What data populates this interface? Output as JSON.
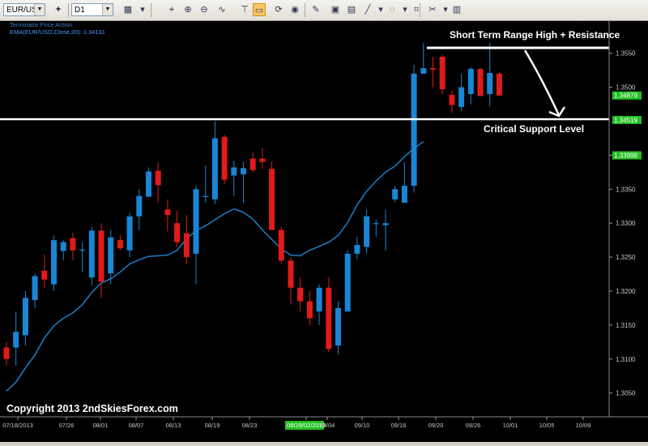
{
  "toolbar": {
    "symbol": "EUR/USD",
    "timeframe": "D1",
    "icons": [
      "add-symbol-icon",
      "layout-icon",
      "chart-type-icon",
      "crosshair-icon",
      "zoom-in-icon",
      "zoom-out-icon",
      "indicators-icon",
      "line-tool-icon",
      "text-tool-icon",
      "alert-icon",
      "template-icon",
      "save-icon",
      "print-icon",
      "draw-line-icon",
      "shape-icon",
      "flag-icon",
      "eraser-icon",
      "settings-icon"
    ]
  },
  "chart_header": {
    "line1": "Terminator Price Action",
    "line2": "EMA(EUR/USD,Close,20): 1.34131"
  },
  "annotations": {
    "resistance_label": "Short Term Range High + Resistance",
    "support_label": "Critical Support Level",
    "copyright": "Copyright 2013 2ndSkiesForex.com"
  },
  "colors": {
    "bull": "#1a86d6",
    "bear": "#e11b1b",
    "ema": "#1a86d6",
    "price_tag": "#22c022",
    "background": "#000000",
    "lines": "#ffffff"
  },
  "chart_data": {
    "type": "candlestick",
    "symbol": "EUR/USD",
    "timeframe": "D1",
    "ylim": [
      1.3015,
      1.3595
    ],
    "y_ticks": [
      "1.3550",
      "1.3500",
      "1.3400",
      "1.3350",
      "1.3300",
      "1.3250",
      "1.3200",
      "1.3150",
      "1.3100",
      "1.3050"
    ],
    "x_ticks": [
      "07/18/2013",
      "07/26",
      "08/01",
      "08/07",
      "08/13",
      "08/19",
      "08/23",
      "08/29/02/2013",
      "09/04",
      "09/10",
      "09/16",
      "09/20",
      "09/26",
      "10/01",
      "10/05",
      "10/09"
    ],
    "price_tags": [
      "1.34879",
      "1.34519",
      "1.33998"
    ],
    "horizontal_levels": {
      "resistance": 1.3558,
      "support": 1.3453
    },
    "ema_name": "EMA(20)",
    "ema": [
      1.3053,
      1.3066,
      1.3087,
      1.3106,
      1.3131,
      1.3149,
      1.316,
      1.3168,
      1.318,
      1.3198,
      1.3212,
      1.3218,
      1.3228,
      1.324,
      1.3246,
      1.3251,
      1.3252,
      1.3253,
      1.326,
      1.3277,
      1.3289,
      1.3296,
      1.3305,
      1.3314,
      1.3321,
      1.3316,
      1.3306,
      1.329,
      1.3276,
      1.3262,
      1.3253,
      1.3252,
      1.326,
      1.3266,
      1.3272,
      1.3282,
      1.3301,
      1.3327,
      1.3347,
      1.3362,
      1.3375,
      1.3384,
      1.3398,
      1.341,
      1.342
    ],
    "candles": [
      {
        "o": 1.3117,
        "h": 1.3125,
        "l": 1.309,
        "c": 1.31
      },
      {
        "o": 1.3117,
        "h": 1.317,
        "l": 1.309,
        "c": 1.314
      },
      {
        "o": 1.3135,
        "h": 1.32,
        "l": 1.312,
        "c": 1.319
      },
      {
        "o": 1.3187,
        "h": 1.3226,
        "l": 1.3175,
        "c": 1.3222
      },
      {
        "o": 1.323,
        "h": 1.3254,
        "l": 1.3204,
        "c": 1.3217
      },
      {
        "o": 1.321,
        "h": 1.3282,
        "l": 1.32,
        "c": 1.3275
      },
      {
        "o": 1.3259,
        "h": 1.3275,
        "l": 1.3245,
        "c": 1.3272
      },
      {
        "o": 1.3278,
        "h": 1.3286,
        "l": 1.3245,
        "c": 1.326
      },
      {
        "o": 1.326,
        "h": 1.3272,
        "l": 1.3228,
        "c": 1.3261
      },
      {
        "o": 1.322,
        "h": 1.3295,
        "l": 1.3208,
        "c": 1.3289
      },
      {
        "o": 1.3289,
        "h": 1.33,
        "l": 1.319,
        "c": 1.3214
      },
      {
        "o": 1.3226,
        "h": 1.329,
        "l": 1.321,
        "c": 1.3279
      },
      {
        "o": 1.3275,
        "h": 1.3282,
        "l": 1.326,
        "c": 1.3263
      },
      {
        "o": 1.326,
        "h": 1.3315,
        "l": 1.325,
        "c": 1.331
      },
      {
        "o": 1.331,
        "h": 1.335,
        "l": 1.329,
        "c": 1.334
      },
      {
        "o": 1.3339,
        "h": 1.3382,
        "l": 1.3338,
        "c": 1.3376
      },
      {
        "o": 1.3377,
        "h": 1.3389,
        "l": 1.3331,
        "c": 1.3356
      },
      {
        "o": 1.332,
        "h": 1.3335,
        "l": 1.3288,
        "c": 1.3312
      },
      {
        "o": 1.33,
        "h": 1.3318,
        "l": 1.3265,
        "c": 1.3272
      },
      {
        "o": 1.3285,
        "h": 1.3312,
        "l": 1.324,
        "c": 1.325
      },
      {
        "o": 1.3255,
        "h": 1.3355,
        "l": 1.321,
        "c": 1.335
      },
      {
        "o": 1.334,
        "h": 1.3385,
        "l": 1.333,
        "c": 1.334
      },
      {
        "o": 1.3335,
        "h": 1.345,
        "l": 1.3328,
        "c": 1.3425
      },
      {
        "o": 1.3427,
        "h": 1.343,
        "l": 1.3357,
        "c": 1.3364
      },
      {
        "o": 1.337,
        "h": 1.3392,
        "l": 1.334,
        "c": 1.3382
      },
      {
        "o": 1.3372,
        "h": 1.339,
        "l": 1.333,
        "c": 1.3381
      },
      {
        "o": 1.3395,
        "h": 1.3405,
        "l": 1.3375,
        "c": 1.3378
      },
      {
        "o": 1.3395,
        "h": 1.341,
        "l": 1.338,
        "c": 1.339
      },
      {
        "o": 1.338,
        "h": 1.3391,
        "l": 1.329,
        "c": 1.329
      },
      {
        "o": 1.329,
        "h": 1.3295,
        "l": 1.324,
        "c": 1.3245
      },
      {
        "o": 1.3245,
        "h": 1.325,
        "l": 1.318,
        "c": 1.3205
      },
      {
        "o": 1.3205,
        "h": 1.322,
        "l": 1.317,
        "c": 1.3185
      },
      {
        "o": 1.3185,
        "h": 1.32,
        "l": 1.315,
        "c": 1.316
      },
      {
        "o": 1.317,
        "h": 1.321,
        "l": 1.315,
        "c": 1.3205
      },
      {
        "o": 1.3205,
        "h": 1.322,
        "l": 1.311,
        "c": 1.3115
      },
      {
        "o": 1.312,
        "h": 1.3185,
        "l": 1.3107,
        "c": 1.3175
      },
      {
        "o": 1.317,
        "h": 1.326,
        "l": 1.317,
        "c": 1.3255
      },
      {
        "o": 1.3255,
        "h": 1.328,
        "l": 1.3247,
        "c": 1.3268
      },
      {
        "o": 1.3265,
        "h": 1.332,
        "l": 1.3255,
        "c": 1.331
      },
      {
        "o": 1.33,
        "h": 1.3305,
        "l": 1.328,
        "c": 1.33
      },
      {
        "o": 1.3297,
        "h": 1.332,
        "l": 1.326,
        "c": 1.33
      },
      {
        "o": 1.3335,
        "h": 1.3355,
        "l": 1.3331,
        "c": 1.335
      },
      {
        "o": 1.333,
        "h": 1.339,
        "l": 1.333,
        "c": 1.3355
      },
      {
        "o": 1.3355,
        "h": 1.3533,
        "l": 1.3345,
        "c": 1.352
      },
      {
        "o": 1.352,
        "h": 1.3565,
        "l": 1.352,
        "c": 1.3528
      },
      {
        "o": 1.3528,
        "h": 1.3545,
        "l": 1.35,
        "c": 1.3526
      },
      {
        "o": 1.3545,
        "h": 1.3548,
        "l": 1.349,
        "c": 1.3497
      },
      {
        "o": 1.3489,
        "h": 1.3495,
        "l": 1.3462,
        "c": 1.3474
      },
      {
        "o": 1.3471,
        "h": 1.352,
        "l": 1.3465,
        "c": 1.35
      },
      {
        "o": 1.349,
        "h": 1.353,
        "l": 1.3475,
        "c": 1.3527
      },
      {
        "o": 1.3527,
        "h": 1.3528,
        "l": 1.3487,
        "c": 1.3487
      },
      {
        "o": 1.349,
        "h": 1.3565,
        "l": 1.3472,
        "c": 1.3521
      },
      {
        "o": 1.352,
        "h": 1.3522,
        "l": 1.3487,
        "c": 1.3488
      }
    ]
  }
}
